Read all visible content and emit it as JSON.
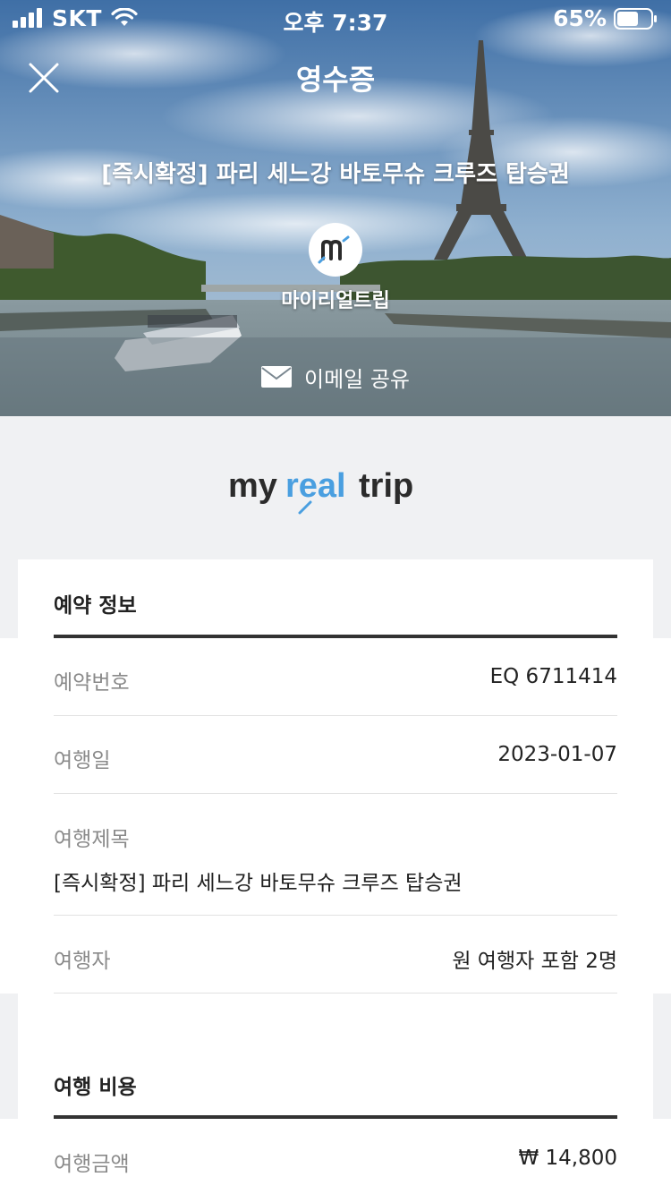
{
  "status_bar": {
    "carrier": "SKT",
    "time": "오후 7:37",
    "battery": "65%",
    "battery_level": 0.65
  },
  "nav": {
    "title": "영수증"
  },
  "hero": {
    "product_title": "[즉시확정] 파리 세느강 바토무슈 크루즈 탑승권",
    "vendor_initial": "m",
    "vendor_name": "마이리얼트립",
    "share_label": "이메일 공유"
  },
  "brand": {
    "logo_text_parts": [
      "my",
      "real",
      "trip"
    ],
    "colors": {
      "dark": "#2b2b2b",
      "accent": "#4a9fe0"
    }
  },
  "booking": {
    "title": "예약 정보",
    "rows": [
      {
        "label": "예약번호",
        "value": "EQ 6711414"
      },
      {
        "label": "여행일",
        "value": "2023-01-07"
      },
      {
        "label": "여행제목",
        "value": "[즉시확정] 파리 세느강 바토무슈 크루즈 탑승권"
      },
      {
        "label": "여행자",
        "value": "원 여행자 포함 2명"
      }
    ]
  },
  "cost": {
    "title": "여행 비용",
    "rows": [
      {
        "label": "여행금액",
        "value": "₩ 14,800"
      }
    ]
  }
}
